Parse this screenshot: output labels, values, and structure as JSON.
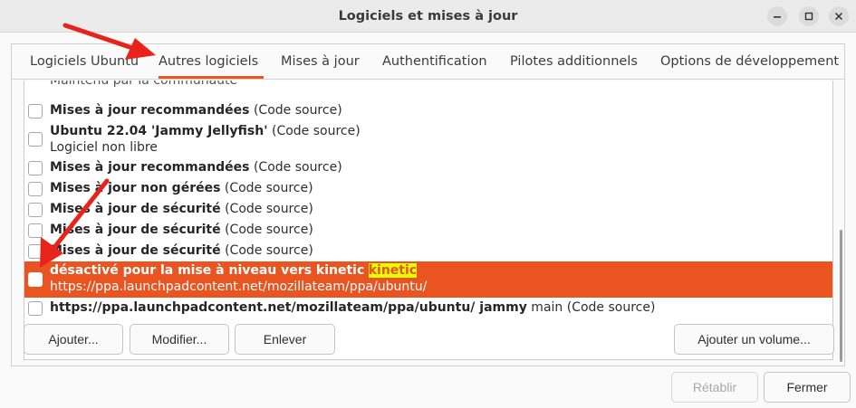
{
  "window": {
    "title": "Logiciels et mises à jour"
  },
  "window_controls": {
    "minimize": "minimize-icon",
    "maximize": "maximize-icon",
    "close": "close-icon"
  },
  "tabs": [
    {
      "label": "Logiciels Ubuntu"
    },
    {
      "label": "Autres logiciels"
    },
    {
      "label": "Mises à jour"
    },
    {
      "label": "Authentification"
    },
    {
      "label": "Pilotes additionnels"
    },
    {
      "label": "Options de développement"
    }
  ],
  "list": {
    "cutoff_text": "Maintenu par la communauté",
    "rows": [
      {
        "bold": "Mises à jour recommandées",
        "rest": " (Code source)"
      },
      {
        "bold": "Ubuntu 22.04 'Jammy Jellyfish'",
        "rest": " (Code source)",
        "line2": "Logiciel non libre"
      },
      {
        "bold": "Mises à jour recommandées",
        "rest": " (Code source)"
      },
      {
        "bold": "Mises à jour non gérées",
        "rest": " (Code source)"
      },
      {
        "bold": "Mises à jour de sécurité",
        "rest": " (Code source)"
      },
      {
        "bold": "Mises à jour de sécurité",
        "rest": " (Code source)"
      },
      {
        "bold": "Mises à jour de sécurité",
        "rest": " (Code source)"
      },
      {
        "bold": "désactivé pour la mise à niveau vers kinetic",
        "highlight": "kinetic",
        "line2": "https://ppa.launchpadcontent.net/mozillateam/ppa/ubuntu/"
      },
      {
        "bold": "https://ppa.launchpadcontent.net/mozillateam/ppa/ubuntu/ jammy",
        "rest": " main (Code source)"
      }
    ]
  },
  "buttons": {
    "add": "Ajouter...",
    "modify": "Modifier...",
    "remove": "Enlever",
    "add_volume": "Ajouter un volume...",
    "revert": "Rétablir",
    "close": "Fermer"
  },
  "colors": {
    "accent": "#e95420",
    "highlight": "#e6ff00",
    "annotation_arrow": "#e8231c"
  }
}
